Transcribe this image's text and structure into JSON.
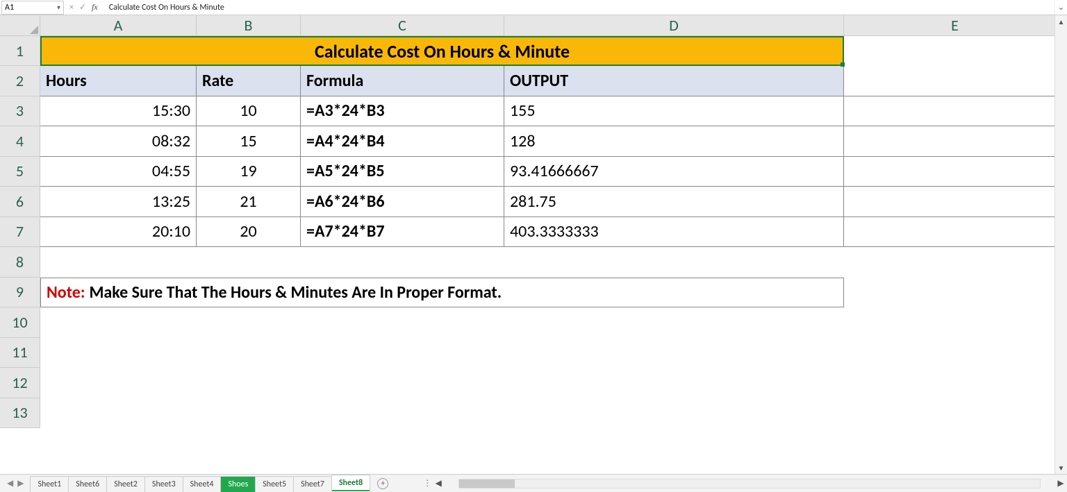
{
  "formulaBar": {
    "nameBox": "A1",
    "cancelGlyph": "×",
    "enterGlyph": "✓",
    "fxGlyph": "fx",
    "content": "Calculate Cost On Hours & Minute",
    "expandGlyph": "⌄"
  },
  "columns": [
    "A",
    "B",
    "C",
    "D",
    "E"
  ],
  "rowNums": [
    "1",
    "2",
    "3",
    "4",
    "5",
    "6",
    "7",
    "8",
    "9",
    "10",
    "11",
    "12",
    "13"
  ],
  "title": "Calculate Cost On Hours & Minute",
  "headers": {
    "A": "Hours",
    "B": "Rate",
    "C": "Formula",
    "D": "OUTPUT"
  },
  "rowsData": [
    {
      "hours": "15:30",
      "rate": "10",
      "formula": "=A3*24*B3",
      "output": "155"
    },
    {
      "hours": "08:32",
      "rate": "15",
      "formula": "=A4*24*B4",
      "output": "128"
    },
    {
      "hours": "04:55",
      "rate": "19",
      "formula": "=A5*24*B5",
      "output": "93.41666667"
    },
    {
      "hours": "13:25",
      "rate": "21",
      "formula": "=A6*24*B6",
      "output": "281.75"
    },
    {
      "hours": "20:10",
      "rate": "20",
      "formula": "=A7*24*B7",
      "output": "403.3333333"
    }
  ],
  "note": {
    "prefix": "Note:",
    "body": "Make Sure That The Hours & Minutes Are In Proper Format."
  },
  "chart_data": {
    "type": "table",
    "title": "Calculate Cost On Hours & Minute",
    "columns": [
      "Hours",
      "Rate",
      "Formula",
      "OUTPUT"
    ],
    "rows": [
      [
        "15:30",
        10,
        "=A3*24*B3",
        155
      ],
      [
        "08:32",
        15,
        "=A4*24*B4",
        128
      ],
      [
        "04:55",
        19,
        "=A5*24*B5",
        93.41666667
      ],
      [
        "13:25",
        21,
        "=A6*24*B6",
        281.75
      ],
      [
        "20:10",
        20,
        "=A7*24*B7",
        403.3333333
      ]
    ]
  },
  "tabs": {
    "items": [
      "Sheet1",
      "Sheet6",
      "Sheet2",
      "Sheet3",
      "Sheet4",
      "Shoes",
      "Sheet5",
      "Sheet7",
      "Sheet8"
    ],
    "greenIndex": 5,
    "activeIndex": 8,
    "addGlyph": "+",
    "navGlyphs": {
      "first": "|◀",
      "prev": "◀",
      "next": "▶",
      "last": "▶|"
    },
    "scrollDots": "⋮",
    "scrollLeft": "◀",
    "scrollRight": "▶"
  },
  "vscroll": {
    "up": "▲",
    "down": "▼"
  }
}
